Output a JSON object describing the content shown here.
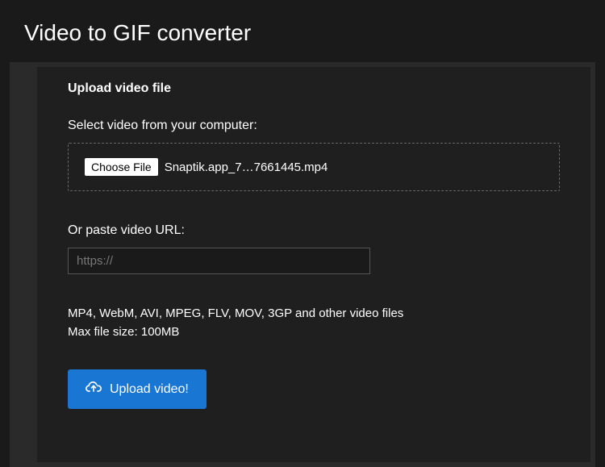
{
  "header": {
    "title": "Video to GIF converter"
  },
  "panel": {
    "title": "Upload video file",
    "select_label": "Select video from your computer:",
    "choose_file_label": "Choose File",
    "selected_filename": "Snaptik.app_7…7661445.mp4",
    "url_label": "Or paste video URL:",
    "url_placeholder": "https://",
    "url_value": "",
    "supported_formats": "MP4, WebM, AVI, MPEG, FLV, MOV, 3GP and other video files",
    "max_size": "Max file size: 100MB",
    "upload_button_label": "Upload video!"
  },
  "colors": {
    "primary": "#1976d2",
    "background": "#1a1a1a",
    "panel_bg": "#1f1f1f"
  }
}
